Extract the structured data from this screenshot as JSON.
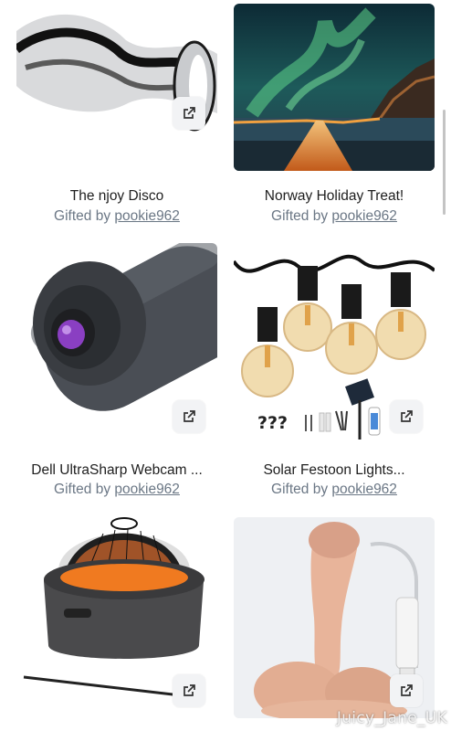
{
  "gifts": [
    {
      "title": "The njoy Disco",
      "gifted_prefix": "Gifted by ",
      "gifter": "pookie962",
      "image": "chrome-toy"
    },
    {
      "title": "Norway Holiday Treat!",
      "gifted_prefix": "Gifted by ",
      "gifter": "pookie962",
      "image": "aurora-landscape"
    },
    {
      "title": "Dell UltraSharp Webcam ...",
      "gifted_prefix": "Gifted by ",
      "gifter": "pookie962",
      "image": "webcam"
    },
    {
      "title": "Solar Festoon Lights...",
      "gifted_prefix": "Gifted by ",
      "gifter": "pookie962",
      "image": "festoon-lights"
    },
    {
      "title": "",
      "gifted_prefix": "",
      "gifter": "",
      "image": "fire-pit"
    },
    {
      "title": "",
      "gifted_prefix": "",
      "gifter": "",
      "image": "flesh-toy"
    }
  ],
  "lights_question_marks": "???",
  "watermark": "Juicy_Jane_UK",
  "icons": {
    "external": "external-link-icon"
  },
  "colors": {
    "title": "#1e1e1e",
    "muted": "#6b7785",
    "button_bg": "#f2f3f5"
  }
}
